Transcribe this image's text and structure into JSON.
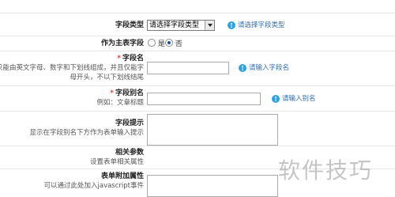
{
  "field_type": {
    "label": "字段类型",
    "select_value": "请选择字段类型",
    "hint": "请选择字段类型"
  },
  "as_main_field": {
    "label": "作为主表字段",
    "options": [
      "是",
      "否"
    ],
    "selected": "否"
  },
  "field_name": {
    "label": "字段名",
    "desc_line1": "只能由英文字母、数字和下划线组成，并且仅能字",
    "desc_line2": "母开头，不以下划线结尾",
    "hint": "请输入字段名"
  },
  "field_alias": {
    "label": "字段别名",
    "desc": "例如：文章标题",
    "hint": "请输入别名"
  },
  "field_tip": {
    "label": "字段提示",
    "desc": "显示在字段别名下方作为表单输入提示"
  },
  "related_params": {
    "label": "相关参数",
    "desc": "设置表单相关属性"
  },
  "form_extra_attrs": {
    "label": "表单附加属性",
    "desc": "可以通过此处加入javascript事件"
  },
  "required_mark": "*",
  "info_icon_glyph": "!",
  "watermark": "软件技巧"
}
